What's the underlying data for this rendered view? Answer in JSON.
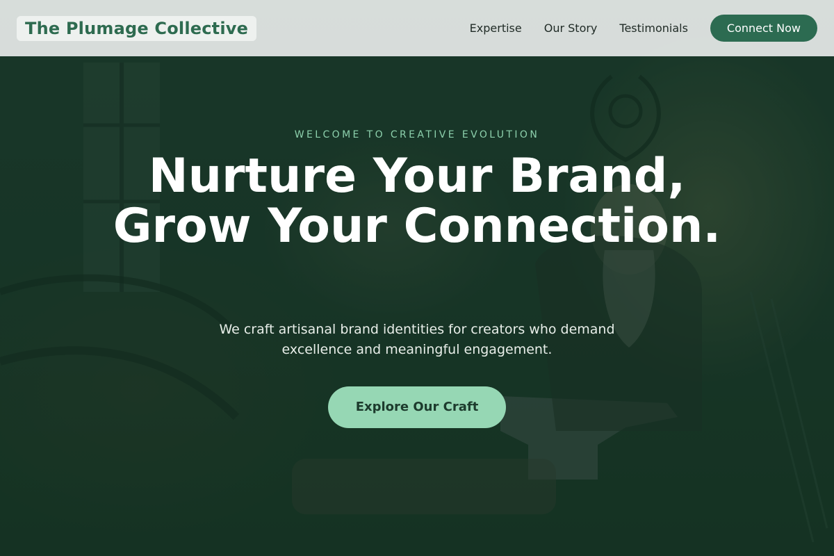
{
  "header": {
    "brand": "The Plumage Collective",
    "nav": [
      {
        "label": "Expertise"
      },
      {
        "label": "Our Story"
      },
      {
        "label": "Testimonials"
      }
    ],
    "cta_label": "Connect Now"
  },
  "hero": {
    "eyebrow": "WELCOME TO CREATIVE EVOLUTION",
    "headline": "Nurture Your Brand, Grow Your Connection.",
    "subhead": "We craft artisanal brand identities for creators who demand excellence and meaningful engagement.",
    "button_label": "Explore Our Craft",
    "background": "photo of an elderly blacksmith with a long white beard working at an anvil in a dim workshop"
  },
  "colors": {
    "brand": "#2e6b50",
    "accent": "#96d7b4",
    "eyebrow": "#8dd1ad",
    "overlay": "#163426"
  }
}
